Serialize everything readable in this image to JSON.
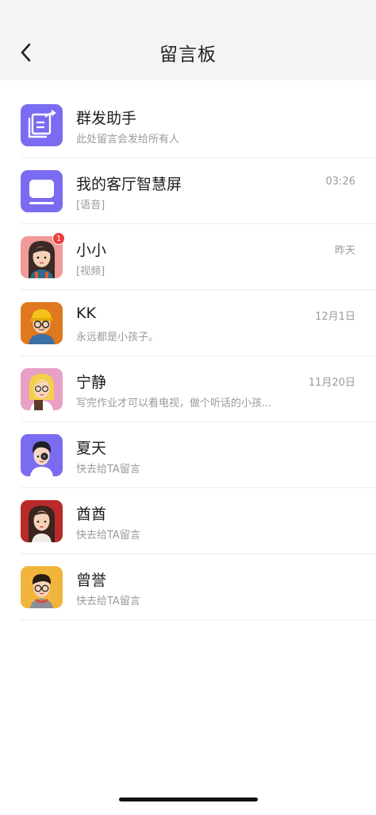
{
  "header": {
    "title": "留言板"
  },
  "rows": [
    {
      "name": "群发助手",
      "sub": "此处留言会发给所有人",
      "time": ""
    },
    {
      "name": "我的客厅智慧屏",
      "sub": "[语音]",
      "time": "03:26"
    },
    {
      "name": "小小",
      "sub": "[视频]",
      "time": "昨天",
      "badge": "1"
    },
    {
      "name": "KK",
      "sub": "永远都是小孩子。",
      "time": "12月1日"
    },
    {
      "name": "宁静",
      "sub": "写完作业才可以看电视，做个听话的小孩...",
      "time": "11月20日"
    },
    {
      "name": "夏天",
      "sub": "快去给TA留言",
      "time": ""
    },
    {
      "name": "酋酋",
      "sub": "快去给TA留言",
      "time": ""
    },
    {
      "name": "曾誉",
      "sub": "快去给TA留言",
      "time": ""
    }
  ],
  "colors": {
    "accent": "#7a6cf0",
    "badge": "#ef3b3b"
  }
}
